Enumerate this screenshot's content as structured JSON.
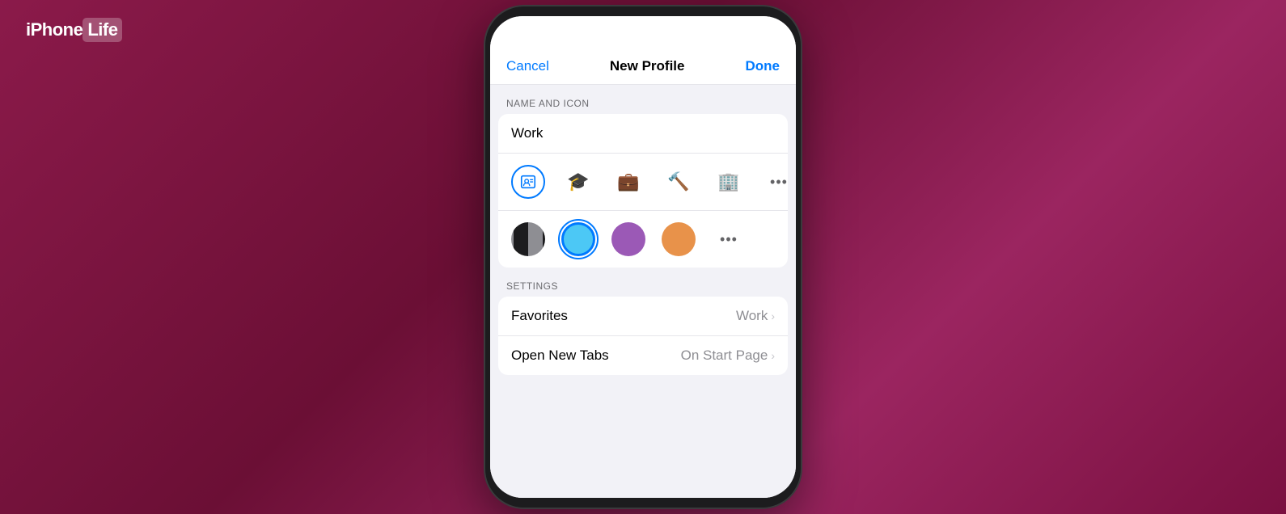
{
  "logo": {
    "iphone": "iPhone",
    "life": "Life"
  },
  "nav": {
    "cancel": "Cancel",
    "title": "New Profile",
    "done": "Done"
  },
  "sections": {
    "name_and_icon": "NAME AND ICON",
    "settings": "SETTINGS"
  },
  "profile": {
    "name": "Work"
  },
  "icons": [
    {
      "id": "contact",
      "label": "contact-card",
      "selected": true,
      "unicode": ""
    },
    {
      "id": "graduation",
      "label": "graduation-cap",
      "selected": false,
      "unicode": "🎓"
    },
    {
      "id": "briefcase",
      "label": "briefcase",
      "selected": false,
      "unicode": "💼"
    },
    {
      "id": "hammer",
      "label": "hammer",
      "selected": false,
      "unicode": "🔨"
    },
    {
      "id": "building",
      "label": "building",
      "selected": false,
      "unicode": "🏢"
    },
    {
      "id": "more",
      "label": "more",
      "selected": false,
      "unicode": "···"
    }
  ],
  "colors": [
    {
      "id": "dark",
      "label": "dark",
      "selected": false
    },
    {
      "id": "blue",
      "label": "blue",
      "selected": true,
      "hex": "#4cc8f5"
    },
    {
      "id": "purple",
      "label": "purple",
      "selected": false,
      "hex": "#9b59b6"
    },
    {
      "id": "orange",
      "label": "orange",
      "selected": false,
      "hex": "#e8924a"
    },
    {
      "id": "more-colors",
      "label": "more",
      "unicode": "···"
    }
  ],
  "settings_rows": [
    {
      "label": "Favorites",
      "value": "Work",
      "chevron": "›"
    },
    {
      "label": "Open New Tabs",
      "value": "On Start Page",
      "chevron": "›"
    }
  ]
}
